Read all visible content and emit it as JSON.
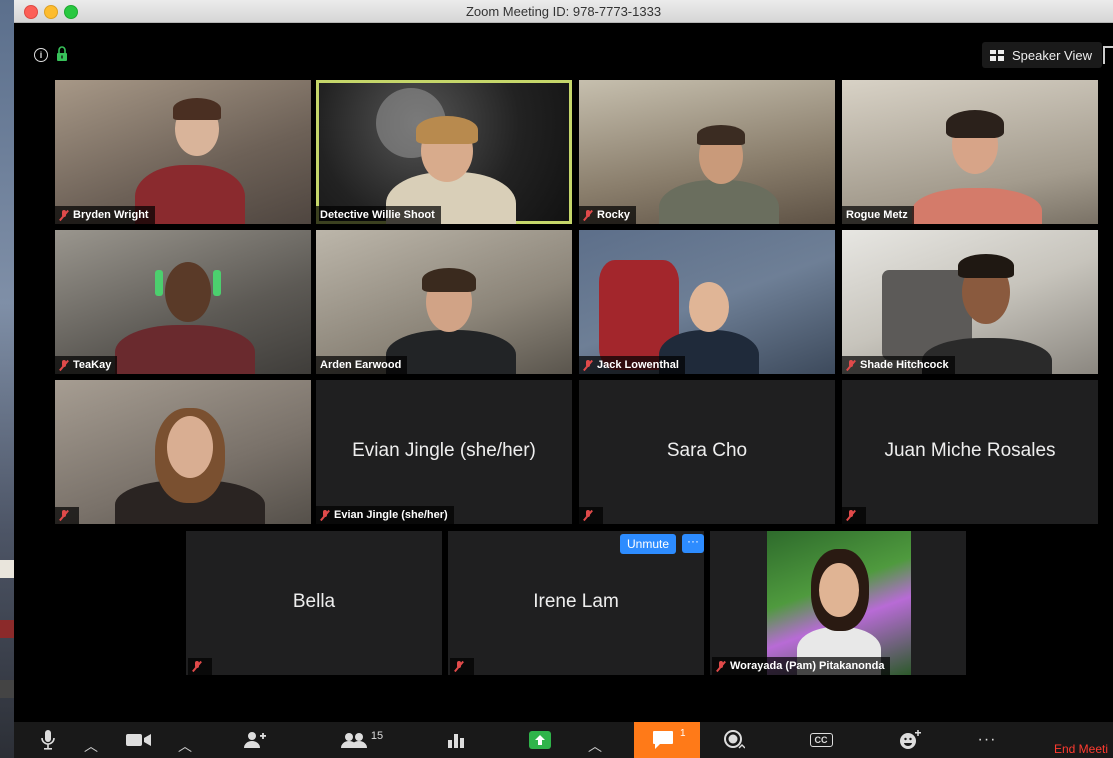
{
  "window": {
    "title": "Zoom Meeting ID: 978-7773-1333"
  },
  "header": {
    "view_label": "Speaker View"
  },
  "participants": [
    {
      "name": "Bryden Wright"
    },
    {
      "name": "Detective Willie Shoot"
    },
    {
      "name": "Rocky"
    },
    {
      "name": "Rogue Metz"
    },
    {
      "name": "TeaKay"
    },
    {
      "name": "Arden Earwood"
    },
    {
      "name": "Jack Lowenthal"
    },
    {
      "name": "Shade Hitchcock"
    },
    {
      "name": ""
    },
    {
      "name": "Evian Jingle (she/her)",
      "display": "Evian Jingle (she/her)"
    },
    {
      "name": "",
      "display": "Sara Cho"
    },
    {
      "name": "",
      "display": "Juan Miche Rosales"
    },
    {
      "name": "",
      "display": "Bella"
    },
    {
      "name": "",
      "display": "Irene Lam"
    },
    {
      "name": "Worayada (Pam) Pitakanonda"
    }
  ],
  "tile_actions": {
    "unmute_label": "Unmute",
    "more_label": "···"
  },
  "toolbar": {
    "participants_count": "15",
    "chat_badge": "1",
    "cc_label": "CC",
    "more_label": "···",
    "end_label": "End Meeti"
  }
}
